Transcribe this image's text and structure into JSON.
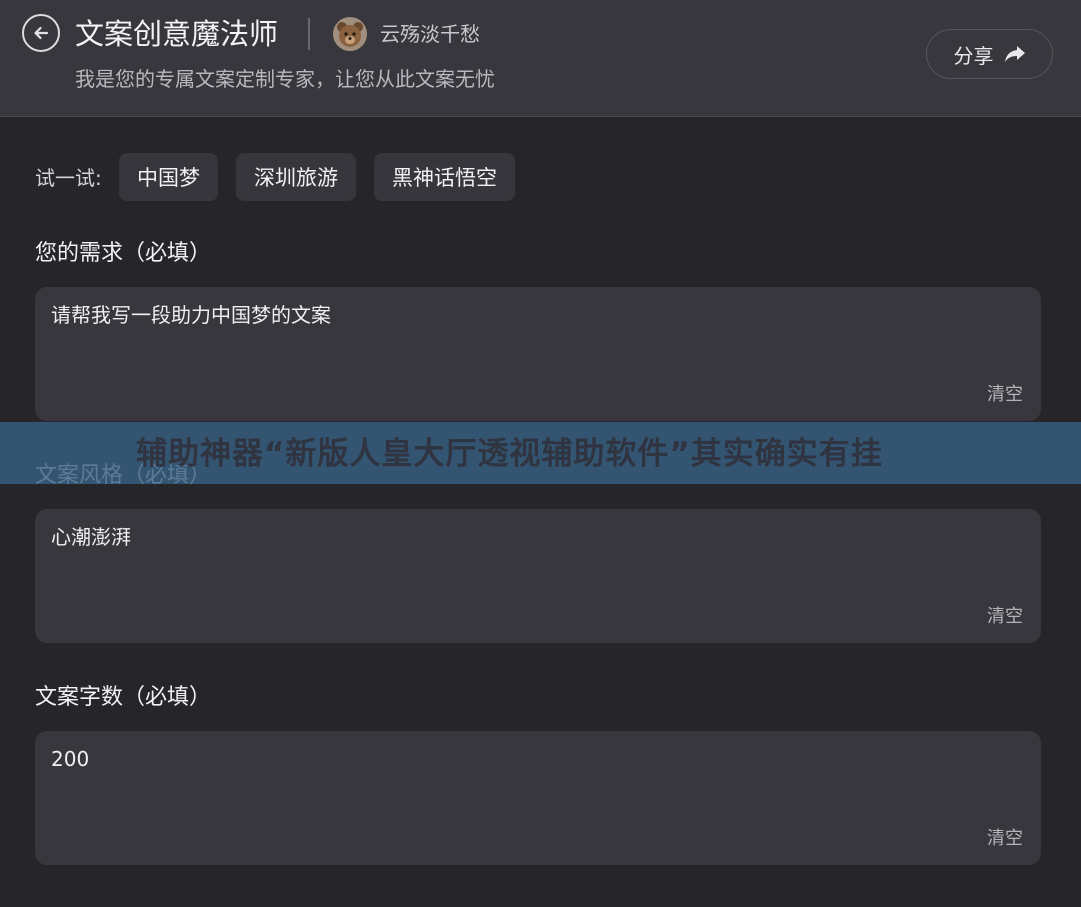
{
  "header": {
    "title": "文案创意魔法师",
    "author": "云殇淡千愁",
    "subtitle": "我是您的专属文案定制专家，让您从此文案无忧",
    "share_label": "分享"
  },
  "try_row": {
    "label": "试一试:",
    "chips": [
      "中国梦",
      "深圳旅游",
      "黑神话悟空"
    ]
  },
  "fields": [
    {
      "label": "您的需求（必填）",
      "value": "请帮我写一段助力中国梦的文案",
      "clear": "清空"
    },
    {
      "label": "文案风格（必填）",
      "value": "心潮澎湃",
      "clear": "清空"
    },
    {
      "label": "文案字数（必填）",
      "value": "200",
      "clear": "清空"
    }
  ],
  "banner": {
    "text": "辅助神器“新版人皇大厅透视辅助软件”其实确实有挂"
  }
}
